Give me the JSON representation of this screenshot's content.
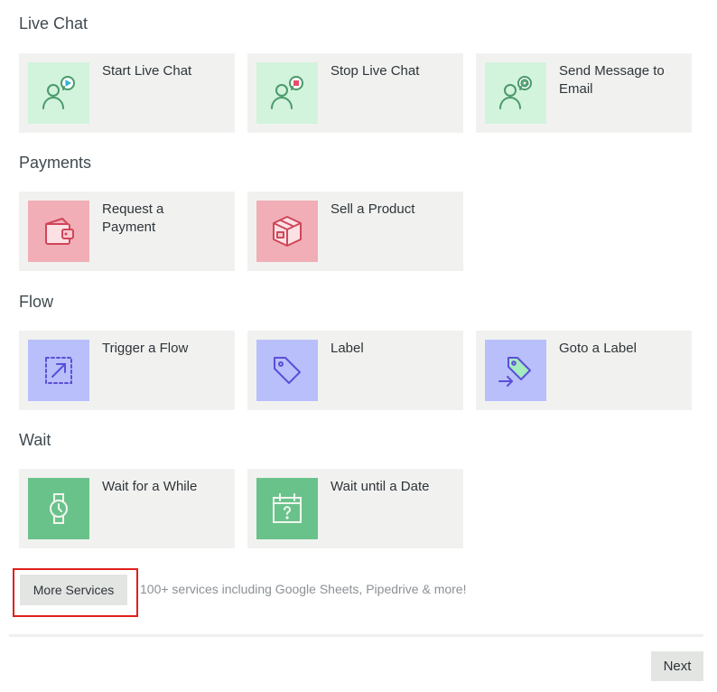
{
  "sections": [
    {
      "title": "Live Chat",
      "items": [
        {
          "label": "Start Live Chat",
          "icon": "person-chat-play-icon"
        },
        {
          "label": "Stop Live Chat",
          "icon": "person-chat-stop-icon"
        },
        {
          "label": "Send Message to Email",
          "icon": "person-chat-email-icon"
        }
      ]
    },
    {
      "title": "Payments",
      "items": [
        {
          "label": "Request a Payment",
          "icon": "wallet-icon"
        },
        {
          "label": "Sell a Product",
          "icon": "box-icon"
        }
      ]
    },
    {
      "title": "Flow",
      "items": [
        {
          "label": "Trigger a Flow",
          "icon": "trigger-arrow-icon"
        },
        {
          "label": "Label",
          "icon": "tag-icon"
        },
        {
          "label": "Goto a Label",
          "icon": "tag-goto-icon"
        }
      ]
    },
    {
      "title": "Wait",
      "items": [
        {
          "label": "Wait for a While",
          "icon": "watch-icon"
        },
        {
          "label": "Wait until a Date",
          "icon": "calendar-question-icon"
        }
      ]
    }
  ],
  "more": {
    "button_label": "More Services",
    "description": "100+ services including Google Sheets, Pipedrive & more!"
  },
  "footer": {
    "next_label": "Next"
  },
  "colors": {
    "live_chat_tile": "#d2f3dc",
    "payments_tile": "#f1aeb6",
    "flow_tile": "#b9bffb",
    "wait_tile": "#6ac28b",
    "highlight": "#e0201c"
  }
}
